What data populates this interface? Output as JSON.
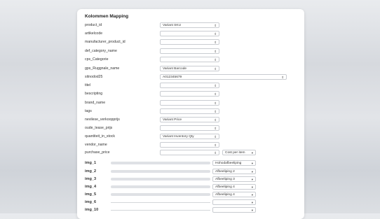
{
  "title": "Kolommen Mapping",
  "rows": [
    {
      "label": "product_id",
      "value": "Variant SKU"
    },
    {
      "label": "artikelcode",
      "value": ""
    },
    {
      "label": "manufacturer_product_id",
      "value": ""
    },
    {
      "label": "def_category_name",
      "value": ""
    },
    {
      "label": "cps_Categorie",
      "value": ""
    },
    {
      "label": "gps_Ruggnale_name",
      "value": "Variant Barcode"
    },
    {
      "label": "sitnodod25",
      "value": "A012345679"
    },
    {
      "label": "titel",
      "value": ""
    },
    {
      "label": "bescripting",
      "value": ""
    },
    {
      "label": "brand_name",
      "value": ""
    },
    {
      "label": "tags",
      "value": ""
    },
    {
      "label": "nevilese_verkoopprijs",
      "value": "Variant Price"
    },
    {
      "label": "oude_lease_prijs",
      "value": ""
    },
    {
      "label": "quantiteit_in_stock",
      "value": "Variant Inventory Qty"
    },
    {
      "label": "vendor_name",
      "value": ""
    },
    {
      "label": "purchase_price",
      "value": "",
      "extra": "Cost per item"
    }
  ],
  "image_rows": [
    {
      "label": "img_1",
      "value": "Hohodafbeeliping"
    },
    {
      "label": "img_2",
      "value": "Afbeeliping 2"
    },
    {
      "label": "img_3",
      "value": "Afbeeliping 3"
    },
    {
      "label": "img_4",
      "value": "Afbeeliping 4"
    },
    {
      "label": "img_5",
      "value": "Afbeeliping 4"
    },
    {
      "label": "img_6",
      "value": ""
    },
    {
      "label": "img_10",
      "value": ""
    }
  ],
  "icons": {
    "chevron": "chevron-updown-icon"
  }
}
